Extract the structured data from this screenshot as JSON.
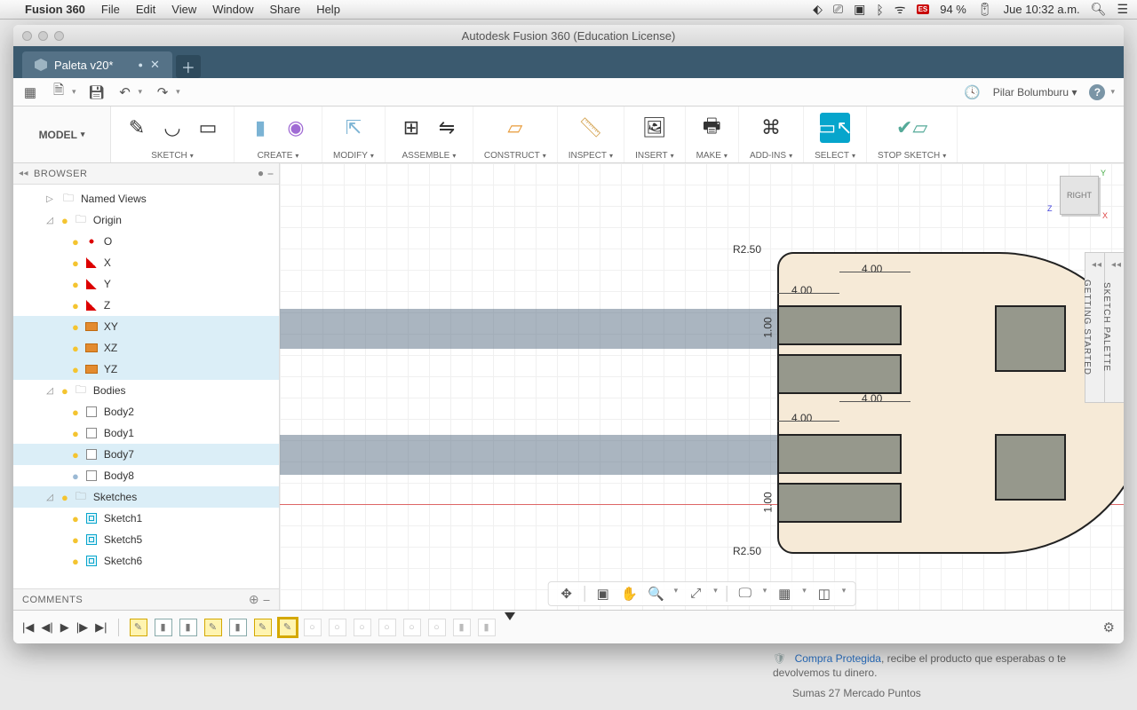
{
  "mac": {
    "app": "Fusion 360",
    "menus": [
      "File",
      "Edit",
      "View",
      "Window",
      "Share",
      "Help"
    ],
    "battery": "94 %",
    "clock": "Jue 10:32 a.m."
  },
  "window": {
    "title": "Autodesk Fusion 360 (Education License)"
  },
  "tab": {
    "name": "Paleta v20*"
  },
  "qat": {
    "user": "Pilar Bolumburu"
  },
  "workspace": "MODEL",
  "ribbon": {
    "groups": [
      "SKETCH",
      "CREATE",
      "MODIFY",
      "ASSEMBLE",
      "CONSTRUCT",
      "INSPECT",
      "INSERT",
      "MAKE",
      "ADD-INS",
      "SELECT",
      "STOP SKETCH"
    ]
  },
  "browser": {
    "title": "BROWSER",
    "named_views": "Named Views",
    "origin": "Origin",
    "o": "O",
    "x": "X",
    "y": "Y",
    "z": "Z",
    "xy": "XY",
    "xz": "XZ",
    "yz": "YZ",
    "bodies": "Bodies",
    "body2": "Body2",
    "body1": "Body1",
    "body7": "Body7",
    "body8": "Body8",
    "sketches": "Sketches",
    "sk1": "Sketch1",
    "sk5": "Sketch5",
    "sk6": "Sketch6"
  },
  "comments": "COMMENTS",
  "viewcube": {
    "face": "RIGHT"
  },
  "dock": {
    "palette": "SKETCH PALETTE",
    "gs": "GETTING STARTED"
  },
  "dims": {
    "r1": "R2.50",
    "r2": "R2.50",
    "d1": "4.00",
    "d2": "4.00",
    "d3": "4.00",
    "d4": "4.00",
    "v1": "1.00",
    "v2": "1.00"
  },
  "behind": {
    "linktext": "Compra Protegida",
    "rest": ", recibe el producto que esperabas o te devolvemos tu dinero.",
    "line2": "Sumas 27 Mercado Puntos"
  }
}
